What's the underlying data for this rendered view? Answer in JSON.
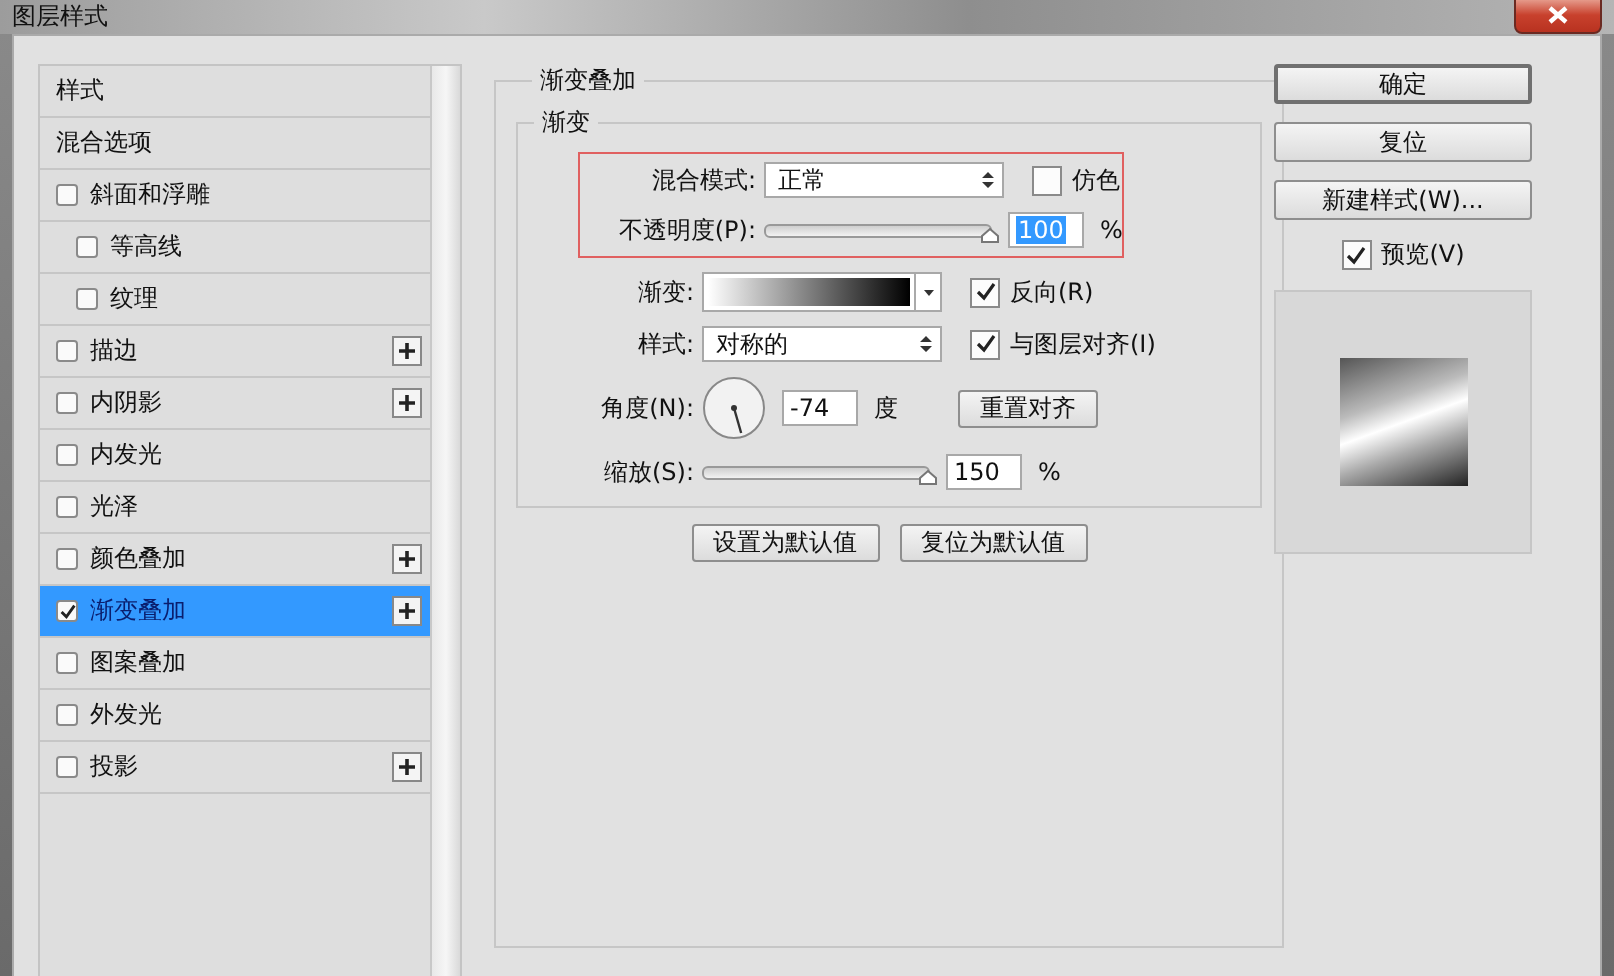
{
  "window": {
    "title": "图层样式"
  },
  "sidebar": {
    "items": [
      {
        "label": "样式",
        "kind": "header",
        "selected": false
      },
      {
        "label": "混合选项",
        "kind": "header",
        "selected": false
      },
      {
        "label": "斜面和浮雕",
        "kind": "checkbox",
        "checked": false,
        "selected": false,
        "has_add": false,
        "children": [
          {
            "label": "等高线",
            "kind": "checkbox",
            "checked": false,
            "selected": false,
            "has_add": false
          },
          {
            "label": "纹理",
            "kind": "checkbox",
            "checked": false,
            "selected": false,
            "has_add": false
          }
        ]
      },
      {
        "label": "描边",
        "kind": "checkbox",
        "checked": false,
        "selected": false,
        "has_add": true
      },
      {
        "label": "内阴影",
        "kind": "checkbox",
        "checked": false,
        "selected": false,
        "has_add": true
      },
      {
        "label": "内发光",
        "kind": "checkbox",
        "checked": false,
        "selected": false,
        "has_add": false
      },
      {
        "label": "光泽",
        "kind": "checkbox",
        "checked": false,
        "selected": false,
        "has_add": false
      },
      {
        "label": "颜色叠加",
        "kind": "checkbox",
        "checked": false,
        "selected": false,
        "has_add": true
      },
      {
        "label": "渐变叠加",
        "kind": "checkbox",
        "checked": true,
        "selected": true,
        "has_add": true
      },
      {
        "label": "图案叠加",
        "kind": "checkbox",
        "checked": false,
        "selected": false,
        "has_add": false
      },
      {
        "label": "外发光",
        "kind": "checkbox",
        "checked": false,
        "selected": false,
        "has_add": false
      },
      {
        "label": "投影",
        "kind": "checkbox",
        "checked": false,
        "selected": false,
        "has_add": true
      }
    ]
  },
  "panel": {
    "title": "渐变叠加",
    "group": "渐变",
    "blend_mode": {
      "label": "混合模式:",
      "value": "正常"
    },
    "dither": {
      "label": "仿色",
      "checked": false
    },
    "opacity": {
      "label": "不透明度(P):",
      "level": 1,
      "value": "100",
      "value_selected": true,
      "unit": "%"
    },
    "gradient": {
      "label": "渐变:"
    },
    "reverse": {
      "label": "反向(R)",
      "checked": true
    },
    "style": {
      "label": "样式:",
      "value": "对称的"
    },
    "align": {
      "label": "与图层对齐(I)",
      "checked": true
    },
    "angle": {
      "label": "角度(N):",
      "value": "-74",
      "unit": "度",
      "reset": "重置对齐"
    },
    "scale": {
      "label": "缩放(S):",
      "level": 1,
      "value": "150",
      "unit": "%"
    },
    "buttons": [
      "设置为默认值",
      "复位为默认值"
    ]
  },
  "actions": {
    "buttons": [
      {
        "label": "确定",
        "default": true
      },
      {
        "label": "复位",
        "default": false
      },
      {
        "label": "新建样式(W)...",
        "default": false
      }
    ],
    "preview": {
      "label": "预览(V)",
      "checked": true
    }
  }
}
